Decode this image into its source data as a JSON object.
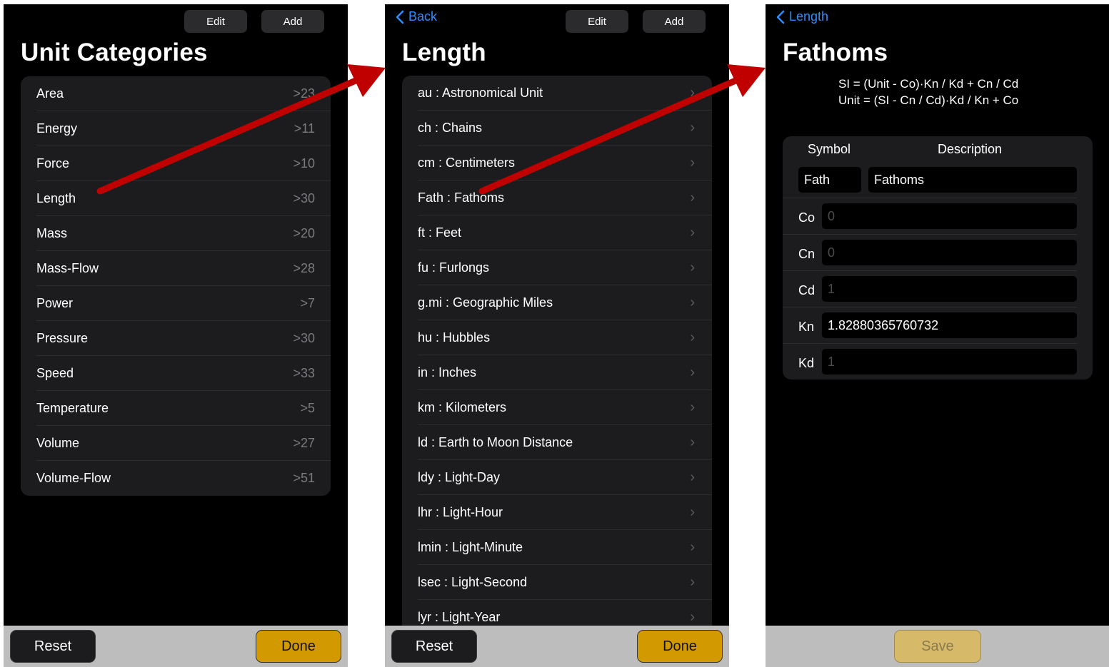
{
  "screen1": {
    "edit_label": "Edit",
    "add_label": "Add",
    "title": "Unit Categories",
    "categories": [
      {
        "label": "Area",
        "count": ">23"
      },
      {
        "label": "Energy",
        "count": ">11"
      },
      {
        "label": "Force",
        "count": ">10"
      },
      {
        "label": "Length",
        "count": ">30"
      },
      {
        "label": "Mass",
        "count": ">20"
      },
      {
        "label": "Mass-Flow",
        "count": ">28"
      },
      {
        "label": "Power",
        "count": ">7"
      },
      {
        "label": "Pressure",
        "count": ">30"
      },
      {
        "label": "Speed",
        "count": ">33"
      },
      {
        "label": "Temperature",
        "count": ">5"
      },
      {
        "label": "Volume",
        "count": ">27"
      },
      {
        "label": "Volume-Flow",
        "count": ">51"
      }
    ],
    "reset_label": "Reset",
    "done_label": "Done"
  },
  "screen2": {
    "back_label": "Back",
    "edit_label": "Edit",
    "add_label": "Add",
    "title": "Length",
    "units": [
      "au : Astronomical Unit",
      "ch : Chains",
      "cm : Centimeters",
      "Fath : Fathoms",
      "ft : Feet",
      "fu : Furlongs",
      "g.mi : Geographic Miles",
      "hu : Hubbles",
      "in : Inches",
      "km : Kilometers",
      "ld : Earth to Moon Distance",
      "ldy : Light-Day",
      "lhr : Light-Hour",
      "lmin : Light-Minute",
      "lsec : Light-Second",
      "lyr : Light-Year"
    ],
    "reset_label": "Reset",
    "done_label": "Done"
  },
  "screen3": {
    "back_label": "Length",
    "title": "Fathoms",
    "formula_si": "SI = (Unit - Co)·Kn / Kd + Cn / Cd",
    "formula_unit": "Unit = (SI - Cn / Cd)·Kd / Kn + Co",
    "symbol_header": "Symbol",
    "description_header": "Description",
    "symbol_value": "Fath",
    "description_value": "Fathoms",
    "params": [
      {
        "label": "Co",
        "value": "0",
        "placeholder": true
      },
      {
        "label": "Cn",
        "value": "0",
        "placeholder": true
      },
      {
        "label": "Cd",
        "value": "1",
        "placeholder": true
      },
      {
        "label": "Kn",
        "value": "1.82880365760732",
        "placeholder": false
      },
      {
        "label": "Kd",
        "value": "1",
        "placeholder": true
      }
    ],
    "save_label": "Save"
  },
  "colors": {
    "accent_blue": "#2f8cff",
    "done_gold": "#d39a00",
    "arrow_red": "#c00000"
  }
}
